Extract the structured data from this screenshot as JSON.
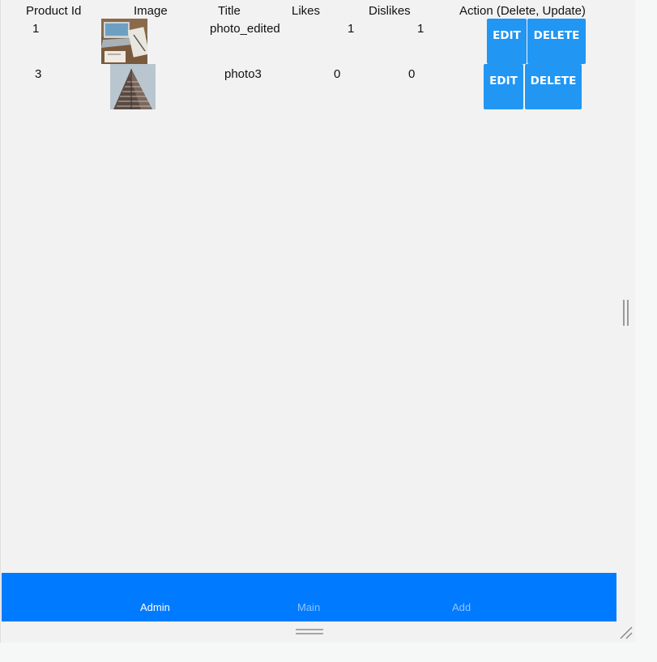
{
  "table": {
    "headers": {
      "product_id": "Product Id",
      "image": "Image",
      "title": "Title",
      "likes": "Likes",
      "dislikes": "Dislikes",
      "action": "Action (Delete, Update)"
    },
    "rows": [
      {
        "id": "1",
        "title": "photo_edited",
        "likes": "1",
        "dislikes": "1",
        "image_icon": "laptop-desk-photo"
      },
      {
        "id": "3",
        "title": "photo3",
        "likes": "0",
        "dislikes": "0",
        "image_icon": "building-photo"
      }
    ],
    "edit_label": "EDIT",
    "delete_label": "DELETE"
  },
  "nav": {
    "items": [
      {
        "label": "Admin",
        "active": true
      },
      {
        "label": "Main",
        "active": false
      },
      {
        "label": "Add",
        "active": false
      }
    ]
  },
  "colors": {
    "button": "#2196f3",
    "nav_background": "#007bff",
    "page_background": "#f2f2f3"
  }
}
